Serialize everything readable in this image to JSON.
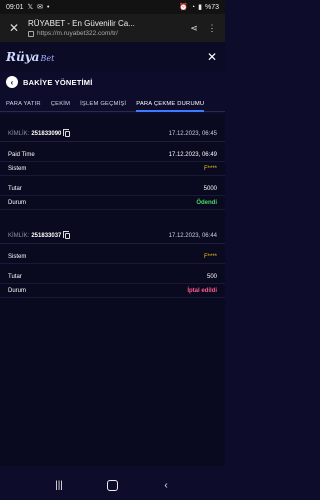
{
  "status_bar": {
    "time": "09:01",
    "battery": "%73"
  },
  "browser": {
    "page_title": "RÜYABET - En Güvenilir Ca...",
    "url": "https://m.ruyabet322.com/tr/"
  },
  "site": {
    "logo_main": "Rüya",
    "logo_sub": "Bet"
  },
  "page": {
    "title": "BAKİYE YÖNETİMİ"
  },
  "tabs": [
    {
      "label": "PARA YATIR",
      "active": false
    },
    {
      "label": "ÇEKİM",
      "active": false
    },
    {
      "label": "İŞLEM GEÇMİŞİ",
      "active": false
    },
    {
      "label": "PARA ÇEKME DURUMU",
      "active": true
    }
  ],
  "withdrawals": [
    {
      "id_label": "KİMLİK:",
      "id": "251833090",
      "created": "17.12.2023, 06:45",
      "paid_time_label": "Paid Time",
      "paid_time": "17.12.2023, 06:49",
      "system_label": "Sistem",
      "system": "F****",
      "amount_label": "Tutar",
      "amount": "5000",
      "status_label": "Durum",
      "status": "Ödendi"
    },
    {
      "id_label": "KİMLİK:",
      "id": "251833037",
      "created": "17.12.2023, 06:44",
      "system_label": "Sistem",
      "system": "F****",
      "amount_label": "Tutar",
      "amount": "500",
      "status_label": "Durum",
      "status": "İptal edildi"
    }
  ],
  "colors": {
    "background": "#0d0d2b",
    "accent": "#3a7bff",
    "paid": "#4cd964",
    "cancelled": "#ff5a8a",
    "system": "#f5c518"
  }
}
